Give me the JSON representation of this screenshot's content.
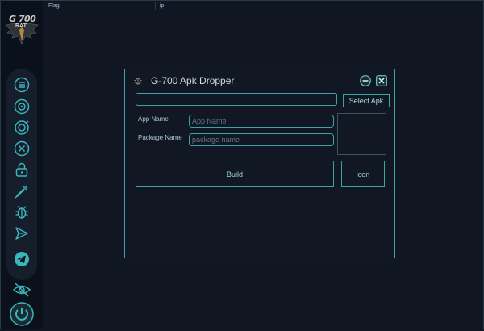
{
  "app": {
    "logo_line1": "G 700",
    "logo_line2": "RAT"
  },
  "sidebar": {
    "items": [
      {
        "icon": "menu-icon"
      },
      {
        "icon": "disc-icon"
      },
      {
        "icon": "target-icon"
      },
      {
        "icon": "cancel-icon"
      },
      {
        "icon": "lock-icon"
      },
      {
        "icon": "syringe-icon"
      },
      {
        "icon": "bug-icon"
      },
      {
        "icon": "send-icon"
      },
      {
        "icon": "telegram-icon"
      }
    ],
    "bottom": [
      "eye-off-icon",
      "power-icon"
    ]
  },
  "table": {
    "columns": [
      "Flag",
      "ip"
    ]
  },
  "dialog": {
    "title": "G-700 Apk Dropper",
    "path_value": "",
    "select_apk_label": "Select Apk",
    "app_name_label": "App Name",
    "app_name_placeholder": "App Name",
    "package_name_label": "Package Name",
    "package_name_placeholder": "package name",
    "build_label": "Build",
    "icon_label": "icon"
  },
  "colors": {
    "background": "#101722",
    "accent": "#3aa3a6",
    "sidebar": "#0b111a"
  }
}
